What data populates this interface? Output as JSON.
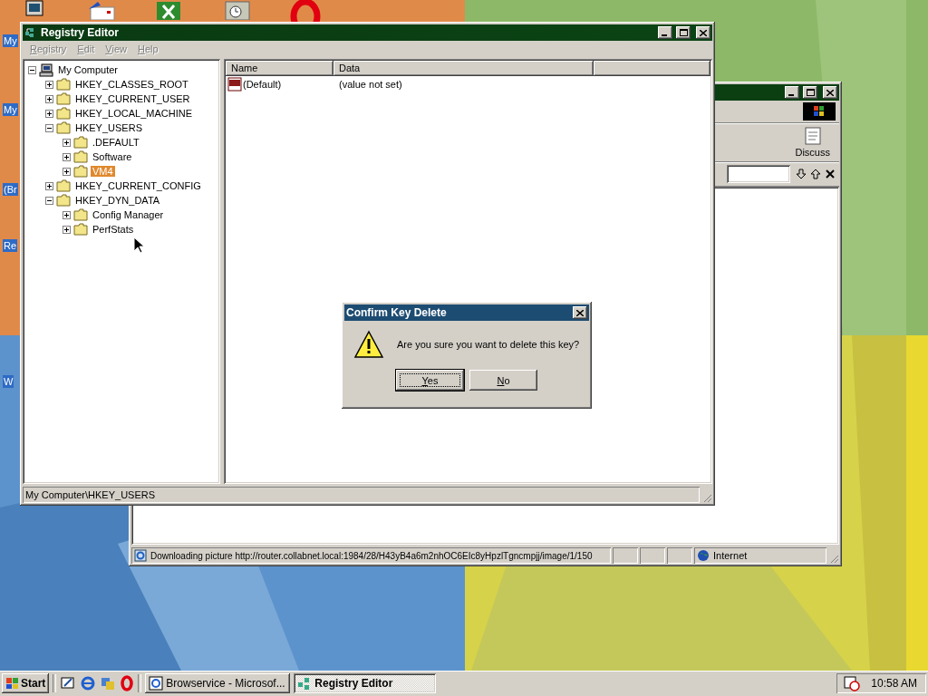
{
  "desktop": {
    "icons": [
      {
        "label": "My"
      },
      {
        "label": "My"
      },
      {
        "label": "(Br"
      },
      {
        "label": "Re"
      },
      {
        "label": "W"
      }
    ]
  },
  "browser_window": {
    "toolbar_button": "Discuss",
    "status_text": "Downloading picture http://router.collabnet.local:1984/28/H43yB4a6m2nhOC6EIc8yHpzlTgncmpjj/image/1/150",
    "zone": "Internet"
  },
  "registry_editor": {
    "title": "Registry Editor",
    "menu": [
      {
        "label": "Registry",
        "disabled": true
      },
      {
        "label": "Edit",
        "disabled": true
      },
      {
        "label": "View",
        "disabled": true
      },
      {
        "label": "Help",
        "disabled": true
      }
    ],
    "tree": [
      {
        "label": "My Computer",
        "kind": "computer",
        "expanded": true,
        "selected": false,
        "children": [
          {
            "label": "HKEY_CLASSES_ROOT",
            "kind": "folder",
            "expanded": false,
            "selected": false
          },
          {
            "label": "HKEY_CURRENT_USER",
            "kind": "folder",
            "expanded": false,
            "selected": false
          },
          {
            "label": "HKEY_LOCAL_MACHINE",
            "kind": "folder",
            "expanded": false,
            "selected": false
          },
          {
            "label": "HKEY_USERS",
            "kind": "folder",
            "expanded": true,
            "selected": false,
            "children": [
              {
                "label": ".DEFAULT",
                "kind": "folder",
                "expanded": false,
                "selected": false
              },
              {
                "label": "Software",
                "kind": "folder",
                "expanded": false,
                "selected": false
              },
              {
                "label": "VM4",
                "kind": "folder",
                "expanded": false,
                "selected": true
              }
            ]
          },
          {
            "label": "HKEY_CURRENT_CONFIG",
            "kind": "folder",
            "expanded": false,
            "selected": false
          },
          {
            "label": "HKEY_DYN_DATA",
            "kind": "folder",
            "expanded": true,
            "selected": false,
            "children": [
              {
                "label": "Config Manager",
                "kind": "folder",
                "expanded": false,
                "selected": false
              },
              {
                "label": "PerfStats",
                "kind": "folder",
                "expanded": false,
                "selected": false
              }
            ]
          }
        ]
      }
    ],
    "columns": [
      "Name",
      "Data"
    ],
    "values": [
      {
        "name": "(Default)",
        "data": "(value not set)"
      }
    ],
    "status": "My Computer\\HKEY_USERS"
  },
  "dialog": {
    "title": "Confirm Key Delete",
    "message": "Are you sure you want to delete this key?",
    "buttons": [
      {
        "label": "Yes",
        "focused": true
      },
      {
        "label": "No",
        "focused": false
      }
    ]
  },
  "taskbar": {
    "start": "Start",
    "tasks": [
      {
        "label": "Browservice - Microsof...",
        "selected": false
      },
      {
        "label": "Registry Editor",
        "selected": true
      }
    ],
    "clock": "10:58 AM"
  }
}
